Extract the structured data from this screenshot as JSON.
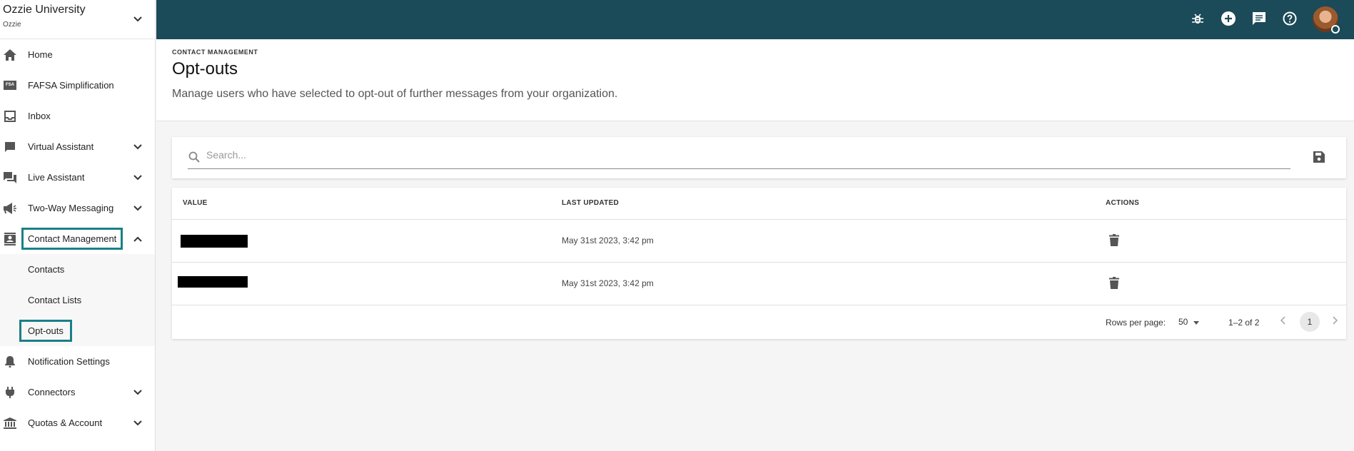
{
  "org": {
    "name": "Ozzie University",
    "sub": "Ozzie"
  },
  "nav": {
    "home": "Home",
    "fafsa": "FAFSA Simplification",
    "fafsa_badge": "FSA",
    "inbox": "Inbox",
    "virtual_assistant": "Virtual Assistant",
    "live_assistant": "Live Assistant",
    "two_way": "Two-Way Messaging",
    "contact_management": "Contact Management",
    "contacts": "Contacts",
    "contact_lists": "Contact Lists",
    "opt_outs": "Opt-outs",
    "notification_settings": "Notification Settings",
    "connectors": "Connectors",
    "quotas": "Quotas & Account"
  },
  "header": {
    "eyebrow": "CONTACT MANAGEMENT",
    "title": "Opt-outs",
    "description": "Manage users who have selected to opt-out of further messages from your organization."
  },
  "search": {
    "placeholder": "Search..."
  },
  "table": {
    "columns": [
      "VALUE",
      "LAST UPDATED",
      "ACTIONS"
    ],
    "rows": [
      {
        "value": "",
        "last_updated": "May 31st 2023, 3:42 pm"
      },
      {
        "value": "",
        "last_updated": "May 31st 2023, 3:42 pm"
      }
    ],
    "footer": {
      "rows_per_page_label": "Rows per page:",
      "rows_per_page": "50",
      "range": "1–2 of 2",
      "page": "1"
    }
  },
  "colors": {
    "topbar": "#1b4a59",
    "highlight": "#1b7f88"
  }
}
